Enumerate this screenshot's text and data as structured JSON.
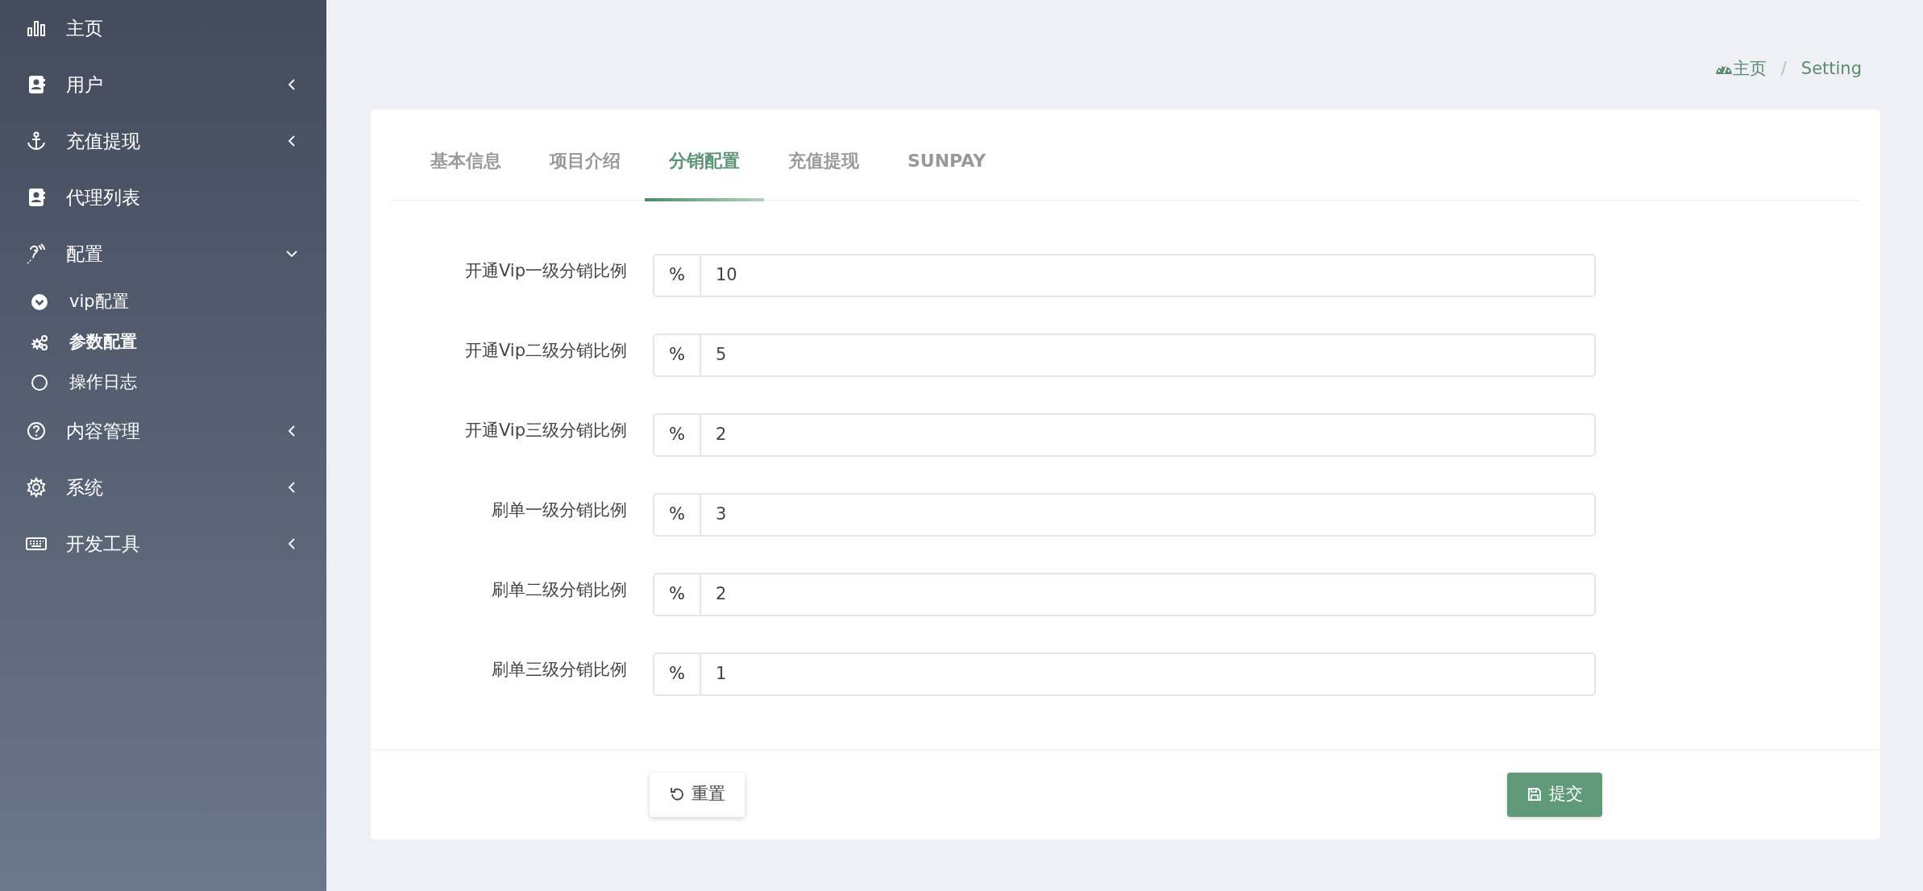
{
  "sidebar": {
    "items": [
      {
        "label": "主页",
        "kind": "link"
      },
      {
        "label": "用户",
        "kind": "group",
        "expanded": false
      },
      {
        "label": "充值提现",
        "kind": "group",
        "expanded": false
      },
      {
        "label": "代理列表",
        "kind": "link"
      },
      {
        "label": "配置",
        "kind": "group",
        "expanded": true,
        "children": [
          {
            "label": "vip配置",
            "selected": false
          },
          {
            "label": "参数配置",
            "selected": true
          },
          {
            "label": "操作日志",
            "selected": false
          }
        ]
      },
      {
        "label": "内容管理",
        "kind": "group",
        "expanded": false
      },
      {
        "label": "系统",
        "kind": "group",
        "expanded": false
      },
      {
        "label": "开发工具",
        "kind": "group",
        "expanded": false
      }
    ]
  },
  "breadcrumb": {
    "items": [
      "主页",
      "Setting"
    ],
    "separator": "/"
  },
  "tabs": [
    {
      "label": "基本信息",
      "selected": false
    },
    {
      "label": "项目介绍",
      "selected": false
    },
    {
      "label": "分销配置",
      "selected": true
    },
    {
      "label": "充值提现",
      "selected": false
    },
    {
      "label": "SUNPAY",
      "selected": false
    }
  ],
  "form": {
    "fields": [
      {
        "label": "开通Vip一级分销比例",
        "prefix": "%",
        "value": "10"
      },
      {
        "label": "开通Vip二级分销比例",
        "prefix": "%",
        "value": "5"
      },
      {
        "label": "开通Vip三级分销比例",
        "prefix": "%",
        "value": "2"
      },
      {
        "label": "刷单一级分销比例",
        "prefix": "%",
        "value": "3"
      },
      {
        "label": "刷单二级分销比例",
        "prefix": "%",
        "value": "2"
      },
      {
        "label": "刷单三级分销比例",
        "prefix": "%",
        "value": "1"
      }
    ],
    "buttons": [
      {
        "label": "重置",
        "kind": "reset"
      },
      {
        "label": "提交",
        "kind": "submit"
      }
    ]
  }
}
